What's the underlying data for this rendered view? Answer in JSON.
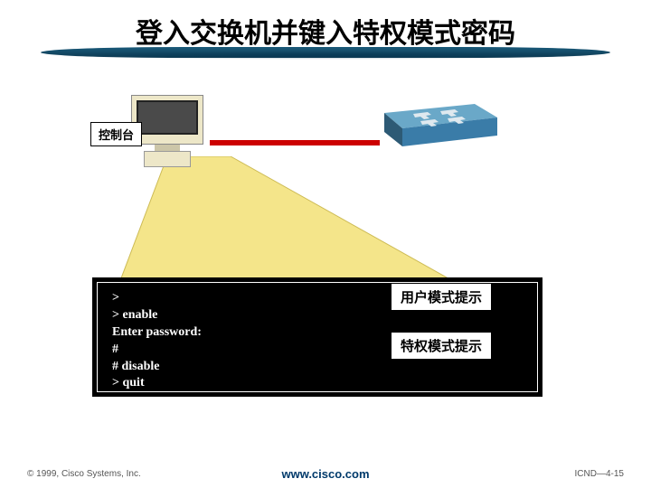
{
  "title": "登入交换机并键入特权模式密码",
  "console_label": "控制台",
  "terminal_lines": {
    "l1": ">",
    "l2": "> enable",
    "l3": "Enter password:",
    "l4": "#",
    "l5": "# disable",
    "l6": "> quit"
  },
  "annotations": {
    "user_mode": "用户模式提示",
    "priv_mode": "特权模式提示"
  },
  "footer": {
    "copyright": "© 1999, Cisco Systems, Inc.",
    "url": "www.cisco.com",
    "page": "ICND—4-15"
  },
  "colors": {
    "beam": "#f4e58a",
    "cable": "#cc0000",
    "switch": "#3a7ca8"
  }
}
